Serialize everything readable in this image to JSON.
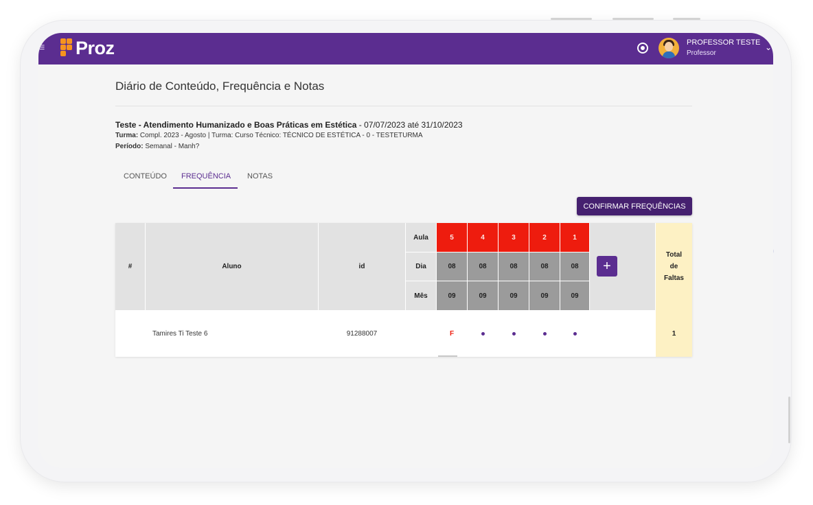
{
  "app": {
    "brand": "Proz",
    "user_name": "PROFESSOR TESTE",
    "user_role": "Professor",
    "accent_color": "#5b2d90",
    "icons": [
      "menu-icon",
      "bell-icon",
      "avatar",
      "chevron-down-icon",
      "plus-icon"
    ]
  },
  "page": {
    "title": "Diário de Conteúdo, Frequência e Notas",
    "course_name": "Teste - Atendimento Humanizado e Boas Práticas em Estética",
    "course_dates": " - 07/07/2023 até 31/10/2023",
    "turma_label": "Turma:",
    "turma_value": " Compl. 2023 - Agosto | Turma: Curso Técnico: TÉCNICO DE ESTÉTICA - 0 - TESTETURMA",
    "periodo_label": "Período:",
    "periodo_value": " Semanal - Manh?"
  },
  "tabs": [
    {
      "label": "CONTEÚDO",
      "active": false
    },
    {
      "label": "FREQUÊNCIA",
      "active": true
    },
    {
      "label": "NOTAS",
      "active": false
    }
  ],
  "confirm_button": "CONFIRMAR FREQUÊNCIAS",
  "table": {
    "headers": {
      "index": "#",
      "student": "Aluno",
      "id": "id",
      "aula": "Aula",
      "dia": "Dia",
      "mes": "Mês",
      "total": "Total de Faltas"
    },
    "total_lines": [
      "Total",
      "de",
      "Faltas"
    ],
    "plus": "+",
    "sessions": [
      {
        "aula": "5",
        "dia": "08",
        "mes": "09"
      },
      {
        "aula": "4",
        "dia": "08",
        "mes": "09"
      },
      {
        "aula": "3",
        "dia": "08",
        "mes": "09"
      },
      {
        "aula": "2",
        "dia": "08",
        "mes": "09"
      },
      {
        "aula": "1",
        "dia": "08",
        "mes": "09"
      }
    ],
    "rows": [
      {
        "name": "Tamires Ti Teste 6",
        "id": "91288007",
        "marks": [
          "F",
          "•",
          "•",
          "•",
          "•"
        ],
        "total": "1"
      }
    ]
  }
}
